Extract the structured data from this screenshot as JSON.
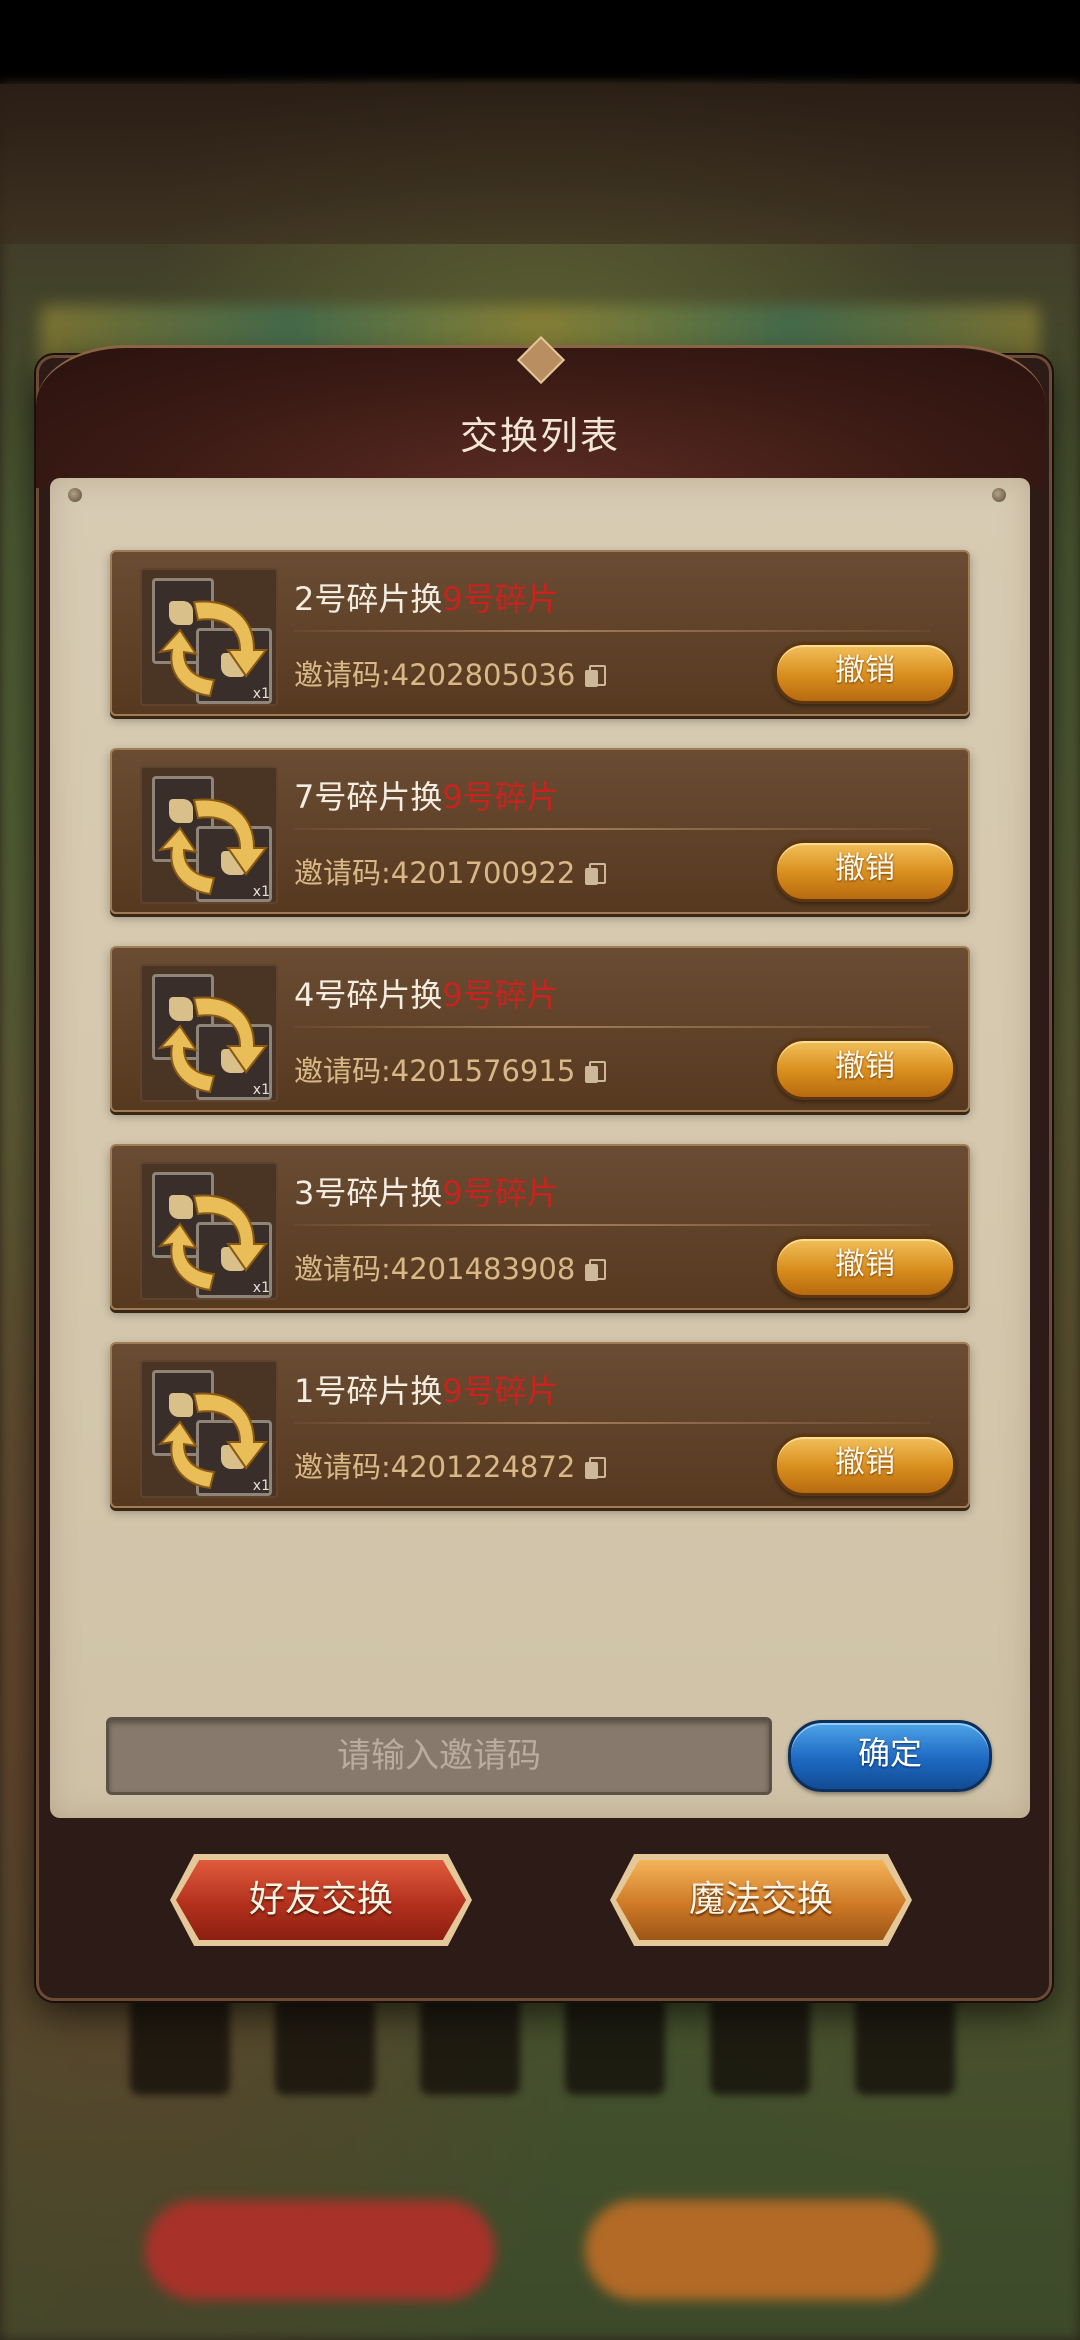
{
  "modal": {
    "title": "交换列表"
  },
  "exchange_list": [
    {
      "title_prefix": "2号碎片换",
      "target": "9号碎片",
      "invite_label": "邀请码:",
      "invite_code": "4202805036",
      "qty": "x1",
      "cancel_label": "撤销"
    },
    {
      "title_prefix": "7号碎片换",
      "target": "9号碎片",
      "invite_label": "邀请码:",
      "invite_code": "4201700922",
      "qty": "x1",
      "cancel_label": "撤销"
    },
    {
      "title_prefix": "4号碎片换",
      "target": "9号碎片",
      "invite_label": "邀请码:",
      "invite_code": "4201576915",
      "qty": "x1",
      "cancel_label": "撤销"
    },
    {
      "title_prefix": "3号碎片换",
      "target": "9号碎片",
      "invite_label": "邀请码:",
      "invite_code": "4201483908",
      "qty": "x1",
      "cancel_label": "撤销"
    },
    {
      "title_prefix": "1号碎片换",
      "target": "9号碎片",
      "invite_label": "邀请码:",
      "invite_code": "4201224872",
      "qty": "x1",
      "cancel_label": "撤销"
    }
  ],
  "invite_input": {
    "value": "",
    "placeholder": "请输入邀请码"
  },
  "confirm_label": "确定",
  "tabs": {
    "friend_exchange": "好友交换",
    "magic_exchange": "魔法交换"
  },
  "colors": {
    "target_text": "#c8231f",
    "cancel_button": "#d88d1c",
    "confirm_button": "#1d69c2",
    "friend_tab": "#b3311d",
    "magic_tab": "#cf7a26"
  }
}
